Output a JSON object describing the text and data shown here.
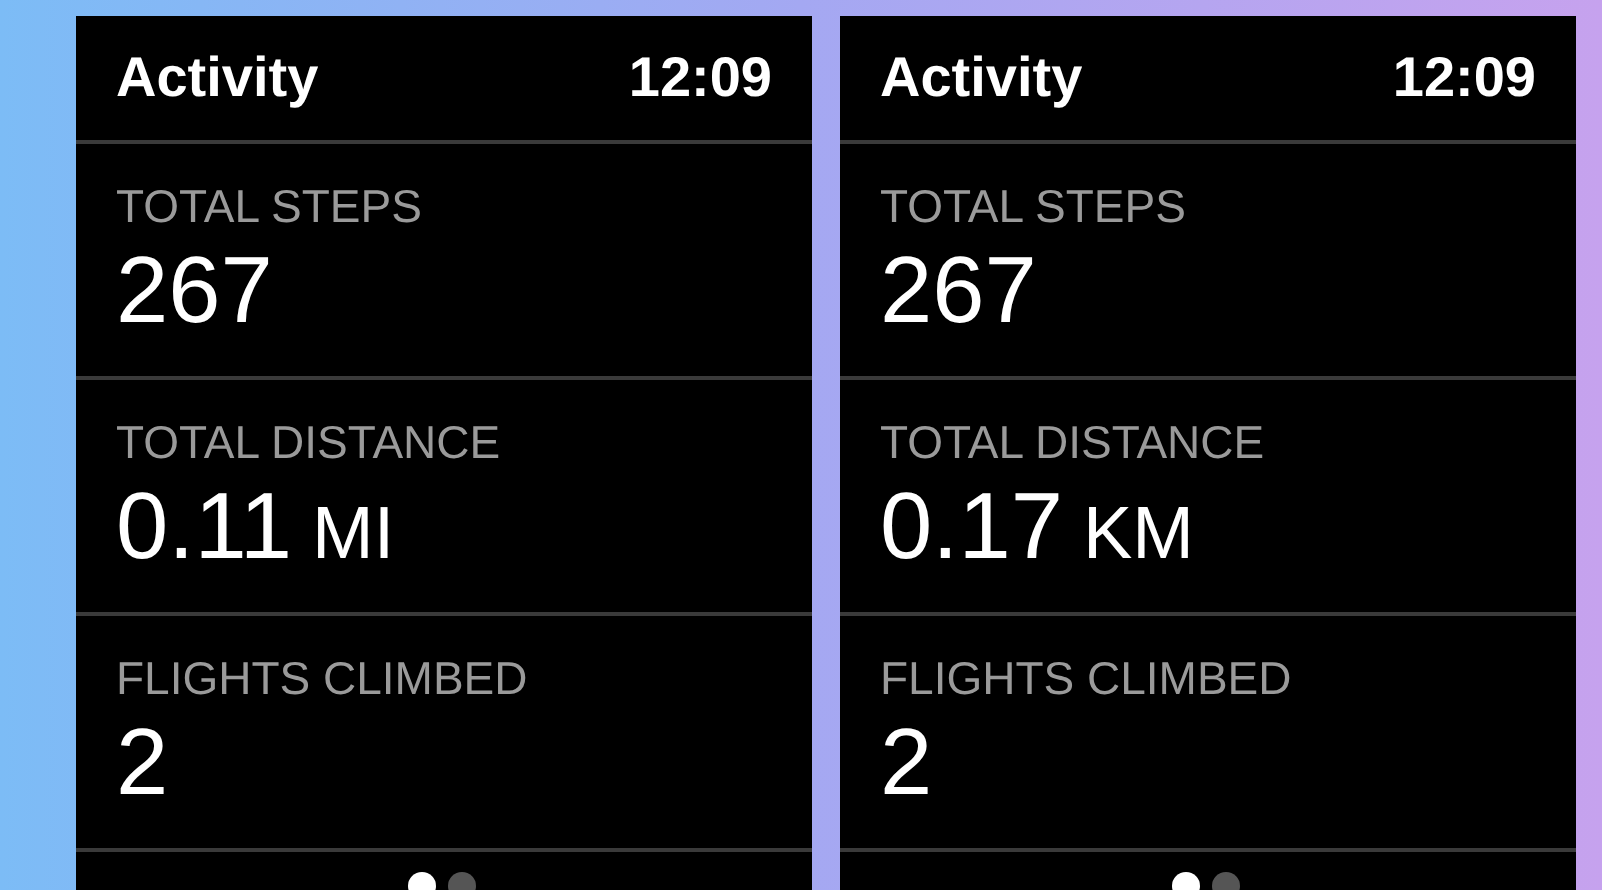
{
  "screens": [
    {
      "title": "Activity",
      "time": "12:09",
      "metrics": [
        {
          "label": "TOTAL STEPS",
          "value": "267"
        },
        {
          "label": "TOTAL DISTANCE",
          "value": "0.11",
          "unit": "MI"
        },
        {
          "label": "FLIGHTS CLIMBED",
          "value": "2"
        }
      ],
      "pages": [
        {
          "selected": true
        },
        {
          "selected": false
        }
      ]
    },
    {
      "title": "Activity",
      "time": "12:09",
      "metrics": [
        {
          "label": "TOTAL STEPS",
          "value": "267"
        },
        {
          "label": "TOTAL DISTANCE",
          "value": "0.17",
          "unit": "KM"
        },
        {
          "label": "FLIGHTS CLIMBED",
          "value": "2"
        }
      ],
      "pages": [
        {
          "selected": true
        },
        {
          "selected": false
        }
      ]
    }
  ]
}
